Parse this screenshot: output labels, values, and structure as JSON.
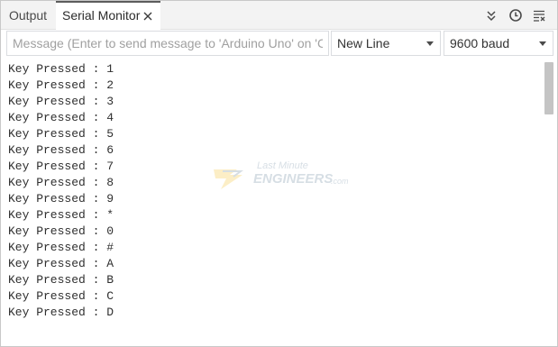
{
  "tabs": {
    "output_label": "Output",
    "serial_label": "Serial Monitor"
  },
  "toolbar": {
    "icons": [
      "collapse-icon",
      "timestamp-clock-icon",
      "clear-output-icon"
    ]
  },
  "message_input": {
    "placeholder": "Message (Enter to send message to 'Arduino Uno' on 'CO...",
    "value": ""
  },
  "line_ending": {
    "selected": "New Line"
  },
  "baud_rate": {
    "selected": "9600 baud"
  },
  "output_lines": [
    "Key Pressed : 1",
    "Key Pressed : 2",
    "Key Pressed : 3",
    "Key Pressed : 4",
    "Key Pressed : 5",
    "Key Pressed : 6",
    "Key Pressed : 7",
    "Key Pressed : 8",
    "Key Pressed : 9",
    "Key Pressed : *",
    "Key Pressed : 0",
    "Key Pressed : #",
    "Key Pressed : A",
    "Key Pressed : B",
    "Key Pressed : C",
    "Key Pressed : D"
  ],
  "watermark": {
    "line1": "Last Minute",
    "line2": "ENGINEERS",
    "line3": ".com"
  },
  "colors": {
    "tab_bar_bg": "#f3f3f3",
    "active_tab_border": "#5c5c5c",
    "text": "#2f2f2f",
    "scrollbar_thumb": "#c4c4c4"
  }
}
